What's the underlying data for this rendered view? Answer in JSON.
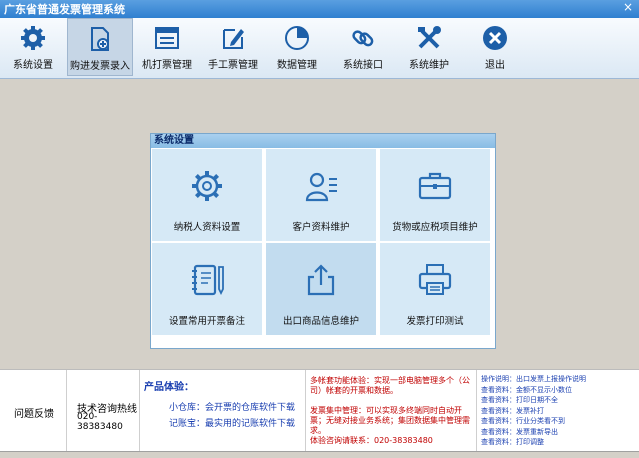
{
  "window": {
    "title": "广东省普通发票管理系统",
    "close": "×"
  },
  "toolbar": [
    {
      "label": "系统设置",
      "icon": "gear-icon"
    },
    {
      "label": "购进发票录入",
      "icon": "doc-add-icon"
    },
    {
      "label": "机打票管理",
      "icon": "window-icon"
    },
    {
      "label": "手工票管理",
      "icon": "edit-icon"
    },
    {
      "label": "数据管理",
      "icon": "pie-chart-icon"
    },
    {
      "label": "系统接口",
      "icon": "link-icon"
    },
    {
      "label": "系统维护",
      "icon": "tools-icon"
    },
    {
      "label": "退出",
      "icon": "close-circle-icon"
    }
  ],
  "panel": {
    "title": "系统设置",
    "cards": [
      {
        "label": "纳税人资料设置",
        "icon": "gear-icon"
      },
      {
        "label": "客户资料维护",
        "icon": "user-card-icon"
      },
      {
        "label": "货物或应税项目维护",
        "icon": "briefcase-icon"
      },
      {
        "label": "设置常用开票备注",
        "icon": "notebook-icon"
      },
      {
        "label": "出口商品信息维护",
        "icon": "export-icon"
      },
      {
        "label": "发票打印测试",
        "icon": "printer-icon"
      }
    ]
  },
  "footer": {
    "feedback": "问题反馈",
    "hotline_title": "技术咨询热线",
    "hotline_number": "020-38383480",
    "product_title": "产品体验：",
    "product_line1": "小仓库：会开票的仓库软件下载",
    "product_line2": "记账宝：最实用的记账软件下载",
    "promo1": "多帐套功能体验：实现一部电脑管理多个（公司）帐套的开票和数据。",
    "promo2": "发票集中管理：可以实现多终端同时自动开票；无缝对接业务系统；集团数据集中管理需求。",
    "promo3": "体验咨询请联系：020-38383480",
    "tips": [
      "操作说明：出口发票上报操作说明",
      "查看资料：金额不显示小数位",
      "查看资料：打印日期不全",
      "查看资料：发票补打",
      "查看资料：行业分类看不到",
      "查看资料：发票重新导出",
      "查看资料：打印调整"
    ]
  }
}
